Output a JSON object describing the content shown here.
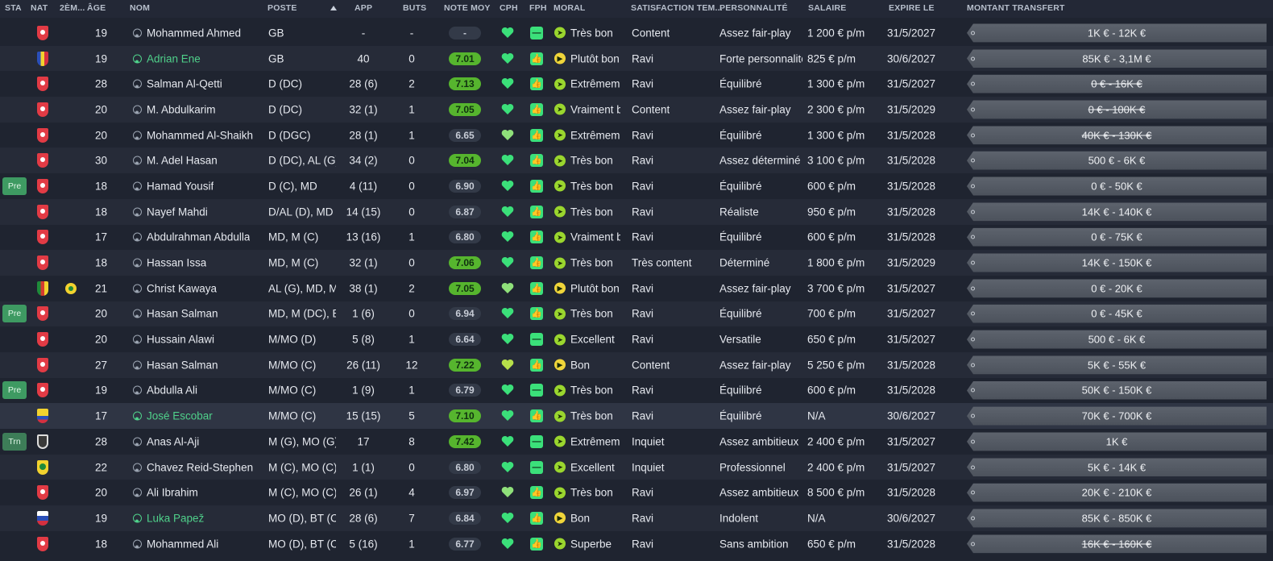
{
  "headers": {
    "sta": "STA",
    "nat": "NAT",
    "nat2": "2ÈM...",
    "age": "ÂGE",
    "nom": "NOM",
    "poste": "POSTE",
    "app": "APP",
    "buts": "BUTS",
    "note": "NOTE MOY",
    "cph": "CPH",
    "fph": "FPH",
    "moral": "MORAL",
    "satisfaction": "SATISFACTION TEM...",
    "personnalite": "PERSONNALITÉ",
    "salaire": "SALAIRE",
    "expire": "EXPIRE LE",
    "montant": "MONTANT TRANSFERT"
  },
  "players": [
    {
      "sta": "",
      "nat": "bhr",
      "nat2": "",
      "age": "19",
      "nom": "Mohammed Ahmed",
      "loan": false,
      "poste": "GB",
      "app": "-",
      "buts": "-",
      "note": "-",
      "noteGood": false,
      "cph": "heart",
      "fph": "minus",
      "moral": "Très bon",
      "moralIcon": "g",
      "sat": "Content",
      "per": "Assez fair-play",
      "sal": "1 200 € p/m",
      "exp": "31/5/2027",
      "mt": "1K € - 12K €",
      "strike": false
    },
    {
      "sta": "",
      "nat": "rou",
      "nat2": "",
      "age": "19",
      "nom": "Adrian Ene",
      "loan": true,
      "poste": "GB",
      "app": "40",
      "buts": "0",
      "note": "7.01",
      "noteGood": true,
      "cph": "heart",
      "fph": "thumb",
      "moral": "Plutôt bon",
      "moralIcon": "y",
      "sat": "Ravi",
      "per": "Forte personnalité",
      "sal": "825 € p/m",
      "exp": "30/6/2027",
      "mt": "85K € - 3,1M €",
      "strike": false
    },
    {
      "sta": "",
      "nat": "bhr",
      "nat2": "",
      "age": "28",
      "nom": "Salman Al-Qetti",
      "loan": false,
      "poste": "D (DC)",
      "app": "28 (6)",
      "buts": "2",
      "note": "7.13",
      "noteGood": true,
      "cph": "heart2",
      "fph": "thumb",
      "moral": "Extrêmement bon",
      "moralIcon": "g",
      "sat": "Ravi",
      "per": "Équilibré",
      "sal": "1 300 € p/m",
      "exp": "31/5/2027",
      "mt": "0 € - 16K €",
      "strike": true
    },
    {
      "sta": "",
      "nat": "bhr",
      "nat2": "",
      "age": "20",
      "nom": "M. Abdulkarim",
      "loan": false,
      "poste": "D (DC)",
      "app": "32 (1)",
      "buts": "1",
      "note": "7.05",
      "noteGood": true,
      "cph": "heart",
      "fph": "thumb",
      "moral": "Vraiment bon",
      "moralIcon": "g",
      "sat": "Content",
      "per": "Assez fair-play",
      "sal": "2 300 € p/m",
      "exp": "31/5/2029",
      "mt": "0 € - 100K €",
      "strike": true
    },
    {
      "sta": "",
      "nat": "bhr",
      "nat2": "",
      "age": "20",
      "nom": "Mohammed Al-Shaikh",
      "loan": false,
      "poste": "D (DGC)",
      "app": "28 (1)",
      "buts": "1",
      "note": "6.65",
      "noteGood": false,
      "cph": "heart3",
      "fph": "thumb",
      "moral": "Extrêmement bon",
      "moralIcon": "g",
      "sat": "Ravi",
      "per": "Équilibré",
      "sal": "1 300 € p/m",
      "exp": "31/5/2028",
      "mt": "40K € - 130K €",
      "strike": true
    },
    {
      "sta": "",
      "nat": "bhr",
      "nat2": "",
      "age": "30",
      "nom": "M. Adel Hasan",
      "loan": false,
      "poste": "D (DC), AL (G)",
      "app": "34 (2)",
      "buts": "0",
      "note": "7.04",
      "noteGood": true,
      "cph": "heart",
      "fph": "thumb",
      "moral": "Très bon",
      "moralIcon": "g",
      "sat": "Ravi",
      "per": "Assez déterminé",
      "sal": "3 100 € p/m",
      "exp": "31/5/2028",
      "mt": "500 € - 6K €",
      "strike": false
    },
    {
      "sta": "Pre",
      "nat": "bhr",
      "nat2": "",
      "age": "18",
      "nom": "Hamad Yousif",
      "loan": false,
      "poste": "D (C), MD",
      "app": "4 (11)",
      "buts": "0",
      "note": "6.90",
      "noteGood": false,
      "cph": "heart",
      "fph": "thumb",
      "moral": "Très bon",
      "moralIcon": "g",
      "sat": "Ravi",
      "per": "Équilibré",
      "sal": "600 € p/m",
      "exp": "31/5/2028",
      "mt": "0 € - 50K €",
      "strike": false
    },
    {
      "sta": "",
      "nat": "bhr",
      "nat2": "",
      "age": "18",
      "nom": "Nayef Mahdi",
      "loan": false,
      "poste": "D/AL (D), MD",
      "app": "14 (15)",
      "buts": "0",
      "note": "6.87",
      "noteGood": false,
      "cph": "heart",
      "fph": "thumb",
      "moral": "Très bon",
      "moralIcon": "g",
      "sat": "Ravi",
      "per": "Réaliste",
      "sal": "950 € p/m",
      "exp": "31/5/2028",
      "mt": "14K € - 140K €",
      "strike": false
    },
    {
      "sta": "",
      "nat": "bhr",
      "nat2": "",
      "age": "17",
      "nom": "Abdulrahman Abdulla",
      "loan": false,
      "poste": "MD, M (C)",
      "app": "13 (16)",
      "buts": "1",
      "note": "6.80",
      "noteGood": false,
      "cph": "heart",
      "fph": "thumb",
      "moral": "Vraiment bon",
      "moralIcon": "g",
      "sat": "Ravi",
      "per": "Équilibré",
      "sal": "600 € p/m",
      "exp": "31/5/2028",
      "mt": "0 € - 75K €",
      "strike": false
    },
    {
      "sta": "",
      "nat": "bhr",
      "nat2": "",
      "age": "18",
      "nom": "Hassan Issa",
      "loan": false,
      "poste": "MD, M (C)",
      "app": "32 (1)",
      "buts": "0",
      "note": "7.06",
      "noteGood": true,
      "cph": "heart",
      "fph": "thumb",
      "moral": "Très bon",
      "moralIcon": "g",
      "sat": "Très content",
      "per": "Déterminé",
      "sal": "1 800 € p/m",
      "exp": "31/5/2029",
      "mt": "14K € - 150K €",
      "strike": false
    },
    {
      "sta": "",
      "nat": "cmr",
      "nat2": "bra",
      "age": "21",
      "nom": "Christ Kawaya",
      "loan": false,
      "poste": "AL (G), MD, M",
      "app": "38 (1)",
      "buts": "2",
      "note": "7.05",
      "noteGood": true,
      "cph": "heart3",
      "fph": "thumb",
      "moral": "Plutôt bon",
      "moralIcon": "y",
      "sat": "Ravi",
      "per": "Assez fair-play",
      "sal": "3 700 € p/m",
      "exp": "31/5/2027",
      "mt": "0 € - 20K €",
      "strike": false
    },
    {
      "sta": "Pre",
      "nat": "bhr",
      "nat2": "",
      "age": "20",
      "nom": "Hasan Salman",
      "loan": false,
      "poste": "MD, M (DC), BT",
      "app": "1 (6)",
      "buts": "0",
      "note": "6.94",
      "noteGood": false,
      "cph": "heart",
      "fph": "thumb",
      "moral": "Très bon",
      "moralIcon": "g",
      "sat": "Ravi",
      "per": "Équilibré",
      "sal": "700 € p/m",
      "exp": "31/5/2027",
      "mt": "0 € - 45K €",
      "strike": false
    },
    {
      "sta": "",
      "nat": "bhr",
      "nat2": "",
      "age": "20",
      "nom": "Hussain Alawi",
      "loan": false,
      "poste": "M/MO (D)",
      "app": "5 (8)",
      "buts": "1",
      "note": "6.64",
      "noteGood": false,
      "cph": "heart",
      "fph": "minus",
      "moral": "Excellent",
      "moralIcon": "g",
      "sat": "Ravi",
      "per": "Versatile",
      "sal": "650 € p/m",
      "exp": "31/5/2027",
      "mt": "500 € - 6K €",
      "strike": false
    },
    {
      "sta": "",
      "nat": "bhr",
      "nat2": "",
      "age": "27",
      "nom": "Hasan Salman",
      "loan": false,
      "poste": "M/MO (C)",
      "app": "26 (11)",
      "buts": "12",
      "note": "7.22",
      "noteGood": true,
      "cph": "heart4",
      "fph": "thumb",
      "moral": "Bon",
      "moralIcon": "y",
      "sat": "Content",
      "per": "Assez fair-play",
      "sal": "5 250 € p/m",
      "exp": "31/5/2028",
      "mt": "5K € - 55K €",
      "strike": false
    },
    {
      "sta": "Pre",
      "nat": "bhr",
      "nat2": "",
      "age": "19",
      "nom": "Abdulla Ali",
      "loan": false,
      "poste": "M/MO (C)",
      "app": "1 (9)",
      "buts": "1",
      "note": "6.79",
      "noteGood": false,
      "cph": "heart",
      "fph": "minus",
      "moral": "Très bon",
      "moralIcon": "g",
      "sat": "Ravi",
      "per": "Équilibré",
      "sal": "600 € p/m",
      "exp": "31/5/2028",
      "mt": "50K € - 150K €",
      "strike": false
    },
    {
      "sta": "",
      "nat": "col",
      "nat2": "",
      "age": "17",
      "nom": "José Escobar",
      "loan": true,
      "poste": "M/MO (C)",
      "app": "15 (15)",
      "buts": "5",
      "note": "7.10",
      "noteGood": true,
      "cph": "heart",
      "fph": "thumb",
      "moral": "Très bon",
      "moralIcon": "g",
      "sat": "Ravi",
      "per": "Équilibré",
      "sal": "N/A",
      "exp": "30/6/2027",
      "mt": "70K € - 700K €",
      "strike": false,
      "hl": true
    },
    {
      "sta": "Trn",
      "nat": "trn2",
      "nat2": "",
      "age": "28",
      "nom": "Anas Al-Aji",
      "loan": false,
      "poste": "M (G), MO (G)",
      "app": "17",
      "buts": "8",
      "note": "7.42",
      "noteGood": true,
      "cph": "heart",
      "fph": "minus",
      "moral": "Extrêmement bon",
      "moralIcon": "g",
      "sat": "Inquiet",
      "per": "Assez ambitieux",
      "sal": "2 400 € p/m",
      "exp": "31/5/2027",
      "mt": "1K €",
      "strike": false
    },
    {
      "sta": "",
      "nat": "bra",
      "nat2": "",
      "age": "22",
      "nom": "Chavez Reid-Stephen",
      "loan": false,
      "poste": "M (C), MO (C)",
      "app": "1 (1)",
      "buts": "0",
      "note": "6.80",
      "noteGood": false,
      "cph": "heart",
      "fph": "minus",
      "moral": "Excellent",
      "moralIcon": "g",
      "sat": "Inquiet",
      "per": "Professionnel",
      "sal": "2 400 € p/m",
      "exp": "31/5/2027",
      "mt": "5K € - 14K €",
      "strike": false
    },
    {
      "sta": "",
      "nat": "bhr",
      "nat2": "",
      "age": "20",
      "nom": "Ali Ibrahim",
      "loan": false,
      "poste": "M (C), MO (C)",
      "app": "26 (1)",
      "buts": "4",
      "note": "6.97",
      "noteGood": false,
      "cph": "heart3",
      "fph": "thumb",
      "moral": "Très bon",
      "moralIcon": "g",
      "sat": "Ravi",
      "per": "Assez ambitieux",
      "sal": "8 500 € p/m",
      "exp": "31/5/2028",
      "mt": "20K € - 210K €",
      "strike": false
    },
    {
      "sta": "",
      "nat": "svn",
      "nat2": "",
      "age": "19",
      "nom": "Luka Papež",
      "loan": true,
      "poste": "MO (D), BT (C)",
      "app": "28 (6)",
      "buts": "7",
      "note": "6.84",
      "noteGood": false,
      "cph": "heart",
      "fph": "thumb",
      "moral": "Bon",
      "moralIcon": "y",
      "sat": "Ravi",
      "per": "Indolent",
      "sal": "N/A",
      "exp": "30/6/2027",
      "mt": "85K € - 850K €",
      "strike": false
    },
    {
      "sta": "",
      "nat": "bhr",
      "nat2": "",
      "age": "18",
      "nom": "Mohammed Ali",
      "loan": false,
      "poste": "MO (D), BT (C)",
      "app": "5 (16)",
      "buts": "1",
      "note": "6.77",
      "noteGood": false,
      "cph": "heart",
      "fph": "thumb",
      "moral": "Superbe",
      "moralIcon": "g",
      "sat": "Ravi",
      "per": "Sans ambition",
      "sal": "650 € p/m",
      "exp": "31/5/2028",
      "mt": "16K € - 160K €",
      "strike": true
    }
  ]
}
